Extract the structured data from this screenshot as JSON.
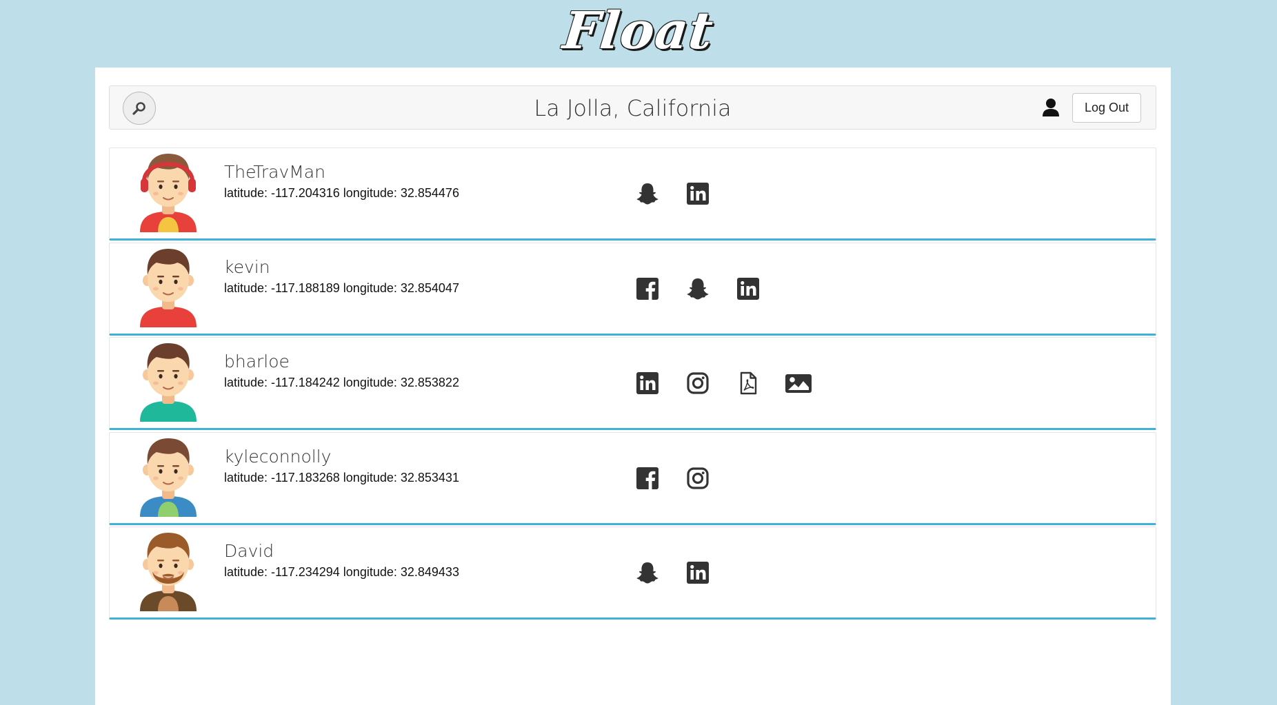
{
  "app": {
    "logo": "Float"
  },
  "header": {
    "location": "La Jolla, California",
    "logout_label": "Log Out",
    "icons": {
      "search": "search-icon",
      "user": "user-icon"
    }
  },
  "users": [
    {
      "name": "TheTravMan",
      "coords": "latitude: -117.204316 longitude: 32.854476",
      "avatar": {
        "hair": "#8b5a3c",
        "shirt": "#e8403a",
        "accent": "#f5c542",
        "headphones": true
      },
      "socials": [
        "snapchat",
        "linkedin"
      ]
    },
    {
      "name": "kevin",
      "coords": "latitude: -117.188189 longitude: 32.854047",
      "avatar": {
        "hair": "#6b3f2b",
        "shirt": "#e8403a",
        "accent": "#e8403a"
      },
      "socials": [
        "facebook",
        "snapchat",
        "linkedin"
      ]
    },
    {
      "name": "bharloe",
      "coords": "latitude: -117.184242 longitude: 32.853822",
      "avatar": {
        "hair": "#6b3f2b",
        "shirt": "#1fb89a",
        "accent": "#1fb89a"
      },
      "socials": [
        "linkedin",
        "instagram",
        "pdf",
        "image"
      ]
    },
    {
      "name": "kyleconnolly",
      "coords": "latitude: -117.183268 longitude: 32.853431",
      "avatar": {
        "hair": "#7a4a34",
        "shirt": "#3b8cc4",
        "accent": "#8fcf6e"
      },
      "socials": [
        "facebook",
        "instagram"
      ]
    },
    {
      "name": "David",
      "coords": "latitude: -117.234294 longitude: 32.849433",
      "avatar": {
        "hair": "#9a5a2a",
        "shirt": "#6b4a2a",
        "accent": "#c98a5a",
        "beard": true
      },
      "socials": [
        "snapchat",
        "linkedin"
      ]
    }
  ],
  "colors": {
    "background": "#bedfea",
    "card_accent": "#3fb1d7",
    "icon": "#333333"
  }
}
